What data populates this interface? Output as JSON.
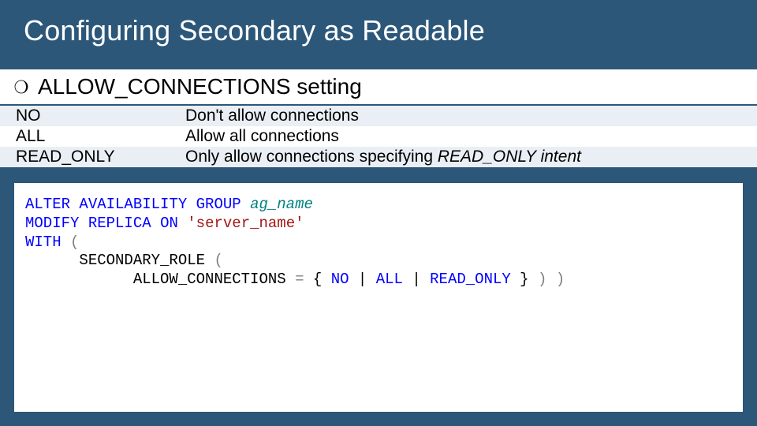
{
  "title": "Configuring Secondary as Readable",
  "section": {
    "keyword": "ALLOW_CONNECTIONS",
    "suffix": "  setting"
  },
  "rows": [
    {
      "key": "NO",
      "desc": "Don't allow connections"
    },
    {
      "key": "ALL",
      "desc": "Allow all connections"
    },
    {
      "key": "READ_ONLY",
      "desc_prefix": "Only allow connections specifying ",
      "desc_ital": "READ_ONLY intent"
    }
  ],
  "code": {
    "l1a": "ALTER",
    "l1b": "AVAILABILITY",
    "l1c": "GROUP",
    "l1d": "ag_name",
    "l2a": "MODIFY",
    "l2b": "REPLICA",
    "l2c": "ON",
    "l2d": "'server_name'",
    "l3a": "WITH",
    "l3b": "(",
    "l4a": "      SECONDARY_ROLE ",
    "l4b": "(",
    "l5a": "            ALLOW_CONNECTIONS ",
    "l5eq": "=",
    "l5b": " { ",
    "l5c": "NO",
    "l5d": " | ",
    "l5e": "ALL",
    "l5f": " | ",
    "l5g": "READ_ONLY",
    "l5h": " } ",
    "l5i": ")",
    "l5j": " ",
    "l5k": ")"
  }
}
